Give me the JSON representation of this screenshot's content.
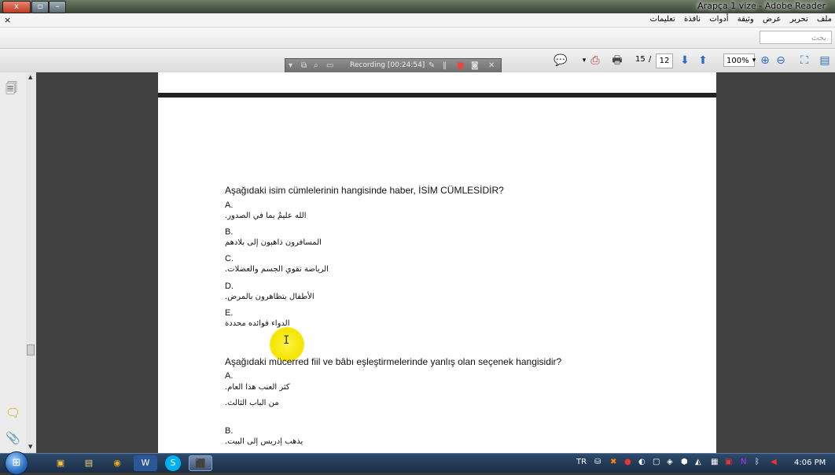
{
  "window": {
    "title": "Arapça 1 vize - Adobe Reader",
    "close_label": "x"
  },
  "menu": {
    "close_glyph": "×",
    "items": [
      "ملف",
      "تحرير",
      "عرض",
      "وثيقة",
      "أدوات",
      "نافذة",
      "تعليمات"
    ]
  },
  "search": {
    "placeholder": "بحث"
  },
  "recording": {
    "label": "Recording [00:24:54]"
  },
  "toolbar": {
    "page_current": "15",
    "page_sep": "/",
    "page_total": "12",
    "zoom": "100%"
  },
  "document": {
    "q1": {
      "text": "Aşağıdaki isim cümlelerinin hangisinde haber, İSİM CÜMLESİDİR?",
      "options": [
        {
          "letter": "A.",
          "arabic": "الله عليمٌ بما في الصدور."
        },
        {
          "letter": "B.",
          "arabic": "المسافرون ذاهبون إلى بلادهم"
        },
        {
          "letter": "C.",
          "arabic": "الرياضة تقوي الجسم والعضلات."
        },
        {
          "letter": "D.",
          "arabic": "الأطفال يتظاهرون بالمرض."
        },
        {
          "letter": "E.",
          "arabic": "الدواء فوائده محددة"
        }
      ]
    },
    "q2": {
      "text": "Aşağıdaki mücerred fiil ve bâbı eşleştirmelerinde yanlış olan seçenek hangisidir?",
      "options": [
        {
          "letter": "A.",
          "arabic": "كثر العنب هذا العام.",
          "arabic2": "من الباب الثالث."
        },
        {
          "letter": "B.",
          "arabic": "يذهب إدريس إلى البيت."
        }
      ]
    }
  },
  "taskbar": {
    "lang": "TR",
    "clock": "4:06 PM"
  }
}
